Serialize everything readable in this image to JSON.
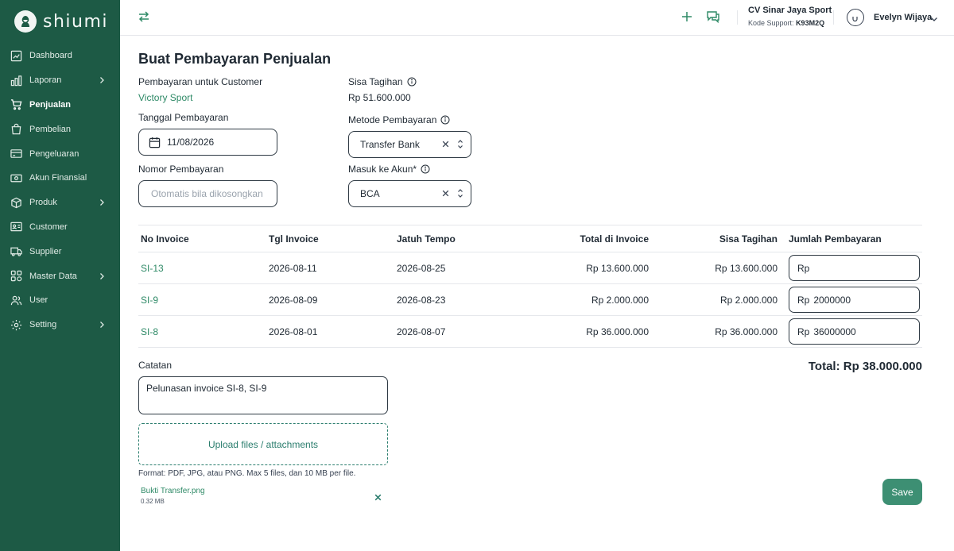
{
  "brand": {
    "name": "shiumi"
  },
  "sidebar": {
    "items": [
      {
        "label": "Dashboard",
        "icon": "chart-line-icon",
        "has_children": false
      },
      {
        "label": "Laporan",
        "icon": "bar-chart-icon",
        "has_children": true
      },
      {
        "label": "Penjualan",
        "icon": "cart-icon",
        "has_children": false,
        "active": true
      },
      {
        "label": "Pembelian",
        "icon": "shopping-bag-icon",
        "has_children": false
      },
      {
        "label": "Pengeluaran",
        "icon": "credit-card-icon",
        "has_children": false
      },
      {
        "label": "Akun Finansial",
        "icon": "banknote-icon",
        "has_children": false
      },
      {
        "label": "Produk",
        "icon": "box-icon",
        "has_children": true
      },
      {
        "label": "Customer",
        "icon": "id-card-icon",
        "has_children": false
      },
      {
        "label": "Supplier",
        "icon": "truck-icon",
        "has_children": false
      },
      {
        "label": "Master Data",
        "icon": "grid-icon",
        "has_children": true
      },
      {
        "label": "User",
        "icon": "users-icon",
        "has_children": false
      },
      {
        "label": "Setting",
        "icon": "gear-icon",
        "has_children": true
      }
    ]
  },
  "topbar": {
    "company_name": "CV Sinar Jaya Sport",
    "support_label": "Kode Support:",
    "support_code": "K93M2Q",
    "user_name": "Evelyn Wijaya"
  },
  "form": {
    "title": "Buat Pembayaran Penjualan",
    "customer_label": "Pembayaran untuk Customer",
    "customer_value": "Victory Sport",
    "remaining_label": "Sisa Tagihan",
    "remaining_value": "Rp 51.600.000",
    "date_label": "Tanggal Pembayaran",
    "date_value": "11/08/2026",
    "method_label": "Metode Pembayaran",
    "method_value": "Transfer Bank",
    "number_label": "Nomor Pembayaran",
    "number_placeholder": "Otomatis bila dikosongkan",
    "account_label": "Masuk ke Akun*",
    "account_value": "BCA"
  },
  "table": {
    "headers": [
      "No Invoice",
      "Tgl Invoice",
      "Jatuh Tempo",
      "Total di Invoice",
      "Sisa Tagihan",
      "Jumlah Pembayaran"
    ],
    "currency_prefix": "Rp",
    "rows": [
      {
        "invoice": "SI-13",
        "date": "2026-08-11",
        "due": "2026-08-25",
        "total": "Rp 13.600.000",
        "remaining": "Rp 13.600.000",
        "payment": ""
      },
      {
        "invoice": "SI-9",
        "date": "2026-08-09",
        "due": "2026-08-23",
        "total": "Rp 2.000.000",
        "remaining": "Rp 2.000.000",
        "payment": "2000000"
      },
      {
        "invoice": "SI-8",
        "date": "2026-08-01",
        "due": "2026-08-07",
        "total": "Rp 36.000.000",
        "remaining": "Rp 36.000.000",
        "payment": "36000000"
      }
    ]
  },
  "notes": {
    "label": "Catatan",
    "value": "Pelunasan invoice SI-8, SI-9"
  },
  "total": "Total: Rp 38.000.000",
  "upload": {
    "label": "Upload files / attachments",
    "hint": "Format: PDF, JPG, atau PNG. Max 5 files, dan 10 MB per file.",
    "files": [
      {
        "name": "Bukti Transfer.png",
        "size": "0.32 MB"
      }
    ]
  },
  "actions": {
    "save_label": "Save"
  },
  "colors": {
    "sidebar": "#1d5a45",
    "accent": "#2f8a67",
    "save": "#3d8f73"
  }
}
